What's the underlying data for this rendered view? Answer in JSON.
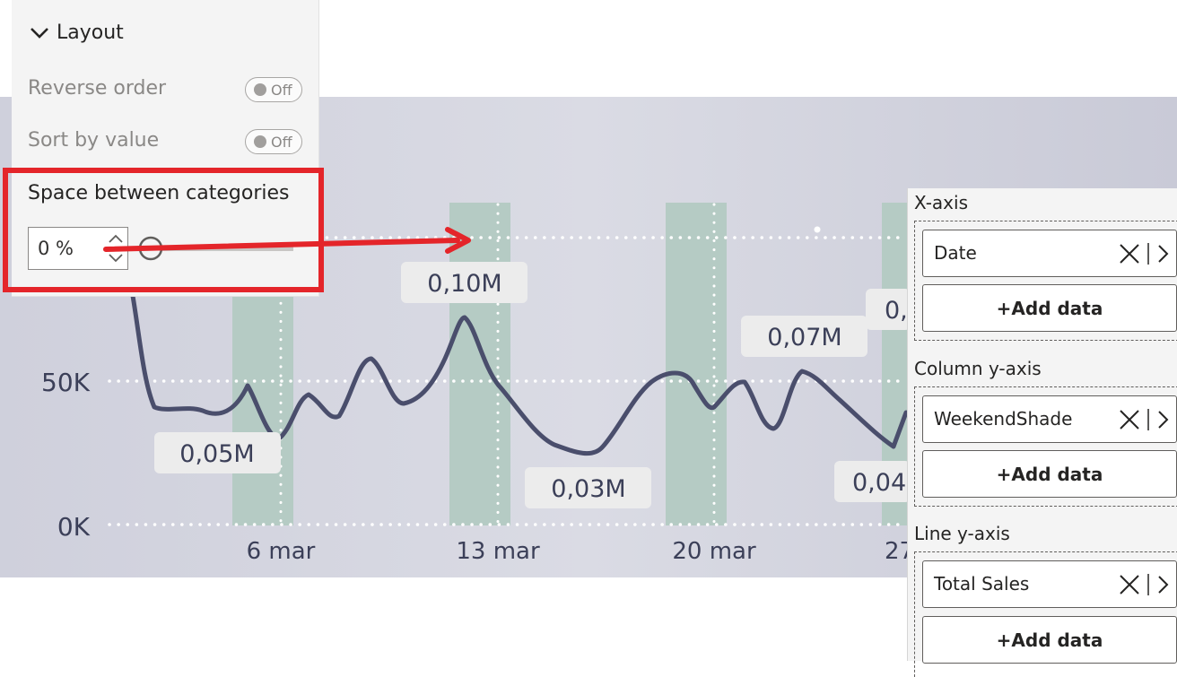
{
  "layout_pane": {
    "header": "Layout",
    "reverse_order": {
      "label": "Reverse order",
      "state": "Off"
    },
    "sort_by_value": {
      "label": "Sort by value",
      "state": "Off"
    },
    "space_between": {
      "label": "Space between categories",
      "value": "0 %",
      "slider_fraction": 0
    }
  },
  "fields_pane": {
    "x_axis": {
      "title": "X-axis",
      "field": "Date",
      "add": "+Add data"
    },
    "column_y": {
      "title": "Column y-axis",
      "field": "WeekendShade",
      "add": "+Add data"
    },
    "line_y": {
      "title": "Line y-axis",
      "field": "Total Sales",
      "add": "+Add data"
    }
  },
  "chart_data": {
    "type": "line",
    "y_ticks": [
      "0K",
      "50K"
    ],
    "x_ticks": [
      "6 mar",
      "13 mar",
      "20 mar",
      "27"
    ],
    "data_labels": [
      "0,05M",
      "0,10M",
      "0,03M",
      "0,07M",
      "0,",
      "0,04"
    ],
    "colors": {
      "line": "#4a4e6c",
      "columns": "#b5cbc4",
      "grid": "#ffffff"
    }
  },
  "annotation": {
    "color": "#e4252a"
  }
}
